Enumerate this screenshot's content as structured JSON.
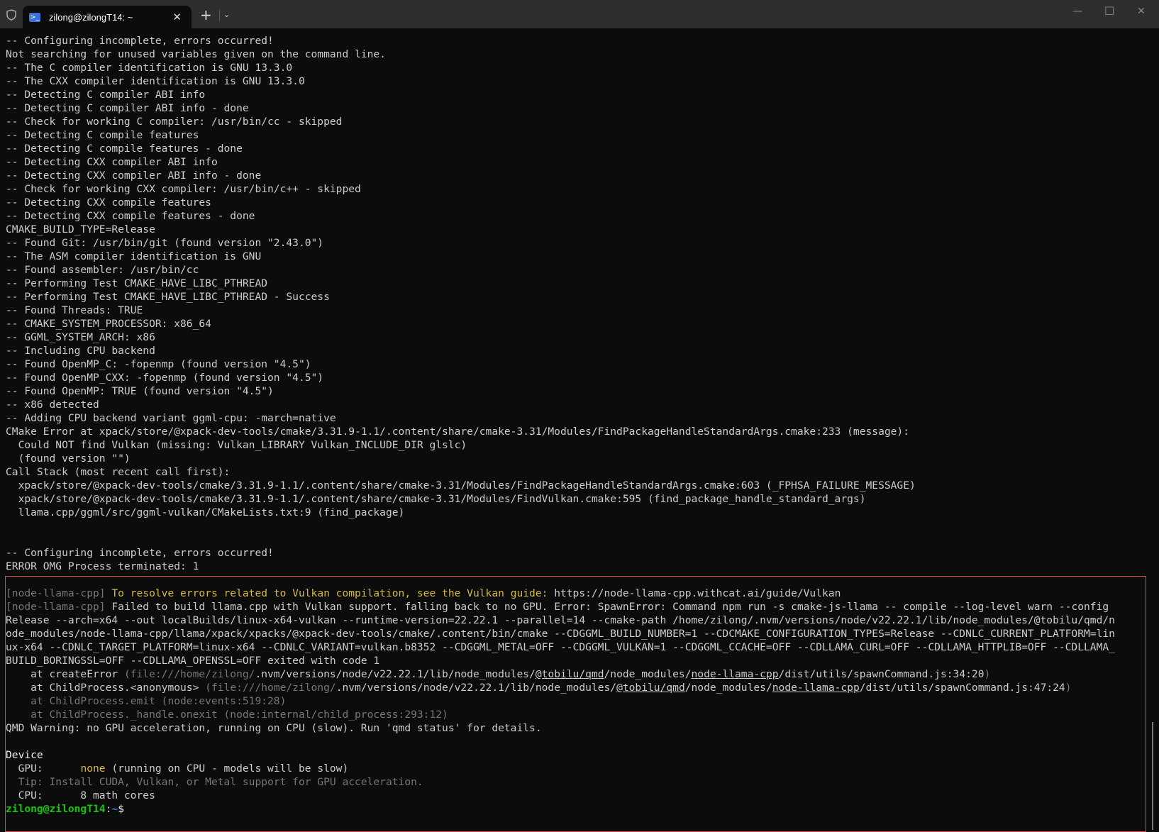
{
  "window": {
    "tab_title": "zilong@zilongT14: ~",
    "tab_icon": "powershell-icon",
    "new_tab": "+",
    "dropdown": "⌄",
    "close_tab": "✕",
    "minimize": "—",
    "maximize": "☐",
    "close": "✕"
  },
  "colors": {
    "error_box": "#e0474f",
    "prompt_user": "#16c60c",
    "prompt_path": "#3b78ff",
    "warning": "#d7b83f"
  },
  "lines": [
    [
      [
        "-- Configuring incomplete, errors occurred!",
        ""
      ]
    ],
    [
      [
        "Not searching for unused variables given on the command line.",
        ""
      ]
    ],
    [
      [
        "-- The C compiler identification is GNU 13.3.0",
        ""
      ]
    ],
    [
      [
        "-- The CXX compiler identification is GNU 13.3.0",
        ""
      ]
    ],
    [
      [
        "-- Detecting C compiler ABI info",
        ""
      ]
    ],
    [
      [
        "-- Detecting C compiler ABI info - done",
        ""
      ]
    ],
    [
      [
        "-- Check for working C compiler: /usr/bin/cc - skipped",
        ""
      ]
    ],
    [
      [
        "-- Detecting C compile features",
        ""
      ]
    ],
    [
      [
        "-- Detecting C compile features - done",
        ""
      ]
    ],
    [
      [
        "-- Detecting CXX compiler ABI info",
        ""
      ]
    ],
    [
      [
        "-- Detecting CXX compiler ABI info - done",
        ""
      ]
    ],
    [
      [
        "-- Check for working CXX compiler: /usr/bin/c++ - skipped",
        ""
      ]
    ],
    [
      [
        "-- Detecting CXX compile features",
        ""
      ]
    ],
    [
      [
        "-- Detecting CXX compile features - done",
        ""
      ]
    ],
    [
      [
        "CMAKE_BUILD_TYPE=Release",
        ""
      ]
    ],
    [
      [
        "-- Found Git: /usr/bin/git (found version \"2.43.0\")",
        ""
      ]
    ],
    [
      [
        "-- The ASM compiler identification is GNU",
        ""
      ]
    ],
    [
      [
        "-- Found assembler: /usr/bin/cc",
        ""
      ]
    ],
    [
      [
        "-- Performing Test CMAKE_HAVE_LIBC_PTHREAD",
        ""
      ]
    ],
    [
      [
        "-- Performing Test CMAKE_HAVE_LIBC_PTHREAD - Success",
        ""
      ]
    ],
    [
      [
        "-- Found Threads: TRUE",
        ""
      ]
    ],
    [
      [
        "-- CMAKE_SYSTEM_PROCESSOR: x86_64",
        ""
      ]
    ],
    [
      [
        "-- GGML_SYSTEM_ARCH: x86",
        ""
      ]
    ],
    [
      [
        "-- Including CPU backend",
        ""
      ]
    ],
    [
      [
        "-- Found OpenMP_C: -fopenmp (found version \"4.5\")",
        ""
      ]
    ],
    [
      [
        "-- Found OpenMP_CXX: -fopenmp (found version \"4.5\")",
        ""
      ]
    ],
    [
      [
        "-- Found OpenMP: TRUE (found version \"4.5\")",
        ""
      ]
    ],
    [
      [
        "-- x86 detected",
        ""
      ]
    ],
    [
      [
        "-- Adding CPU backend variant ggml-cpu: -march=native",
        ""
      ]
    ],
    [
      [
        "CMake Error at xpack/store/@xpack-dev-tools/cmake/3.31.9-1.1/.content/share/cmake-3.31/Modules/FindPackageHandleStandardArgs.cmake:233 (message):",
        ""
      ]
    ],
    [
      [
        "  Could NOT find Vulkan (missing: Vulkan_LIBRARY Vulkan_INCLUDE_DIR glslc)",
        ""
      ]
    ],
    [
      [
        "  (found version \"\")",
        ""
      ]
    ],
    [
      [
        "Call Stack (most recent call first):",
        ""
      ]
    ],
    [
      [
        "  xpack/store/@xpack-dev-tools/cmake/3.31.9-1.1/.content/share/cmake-3.31/Modules/FindPackageHandleStandardArgs.cmake:603 (_FPHSA_FAILURE_MESSAGE)",
        ""
      ]
    ],
    [
      [
        "  xpack/store/@xpack-dev-tools/cmake/3.31.9-1.1/.content/share/cmake-3.31/Modules/FindVulkan.cmake:595 (find_package_handle_standard_args)",
        ""
      ]
    ],
    [
      [
        "  llama.cpp/ggml/src/ggml-vulkan/CMakeLists.txt:9 (find_package)",
        ""
      ]
    ],
    [],
    [],
    [
      [
        "-- Configuring incomplete, errors occurred!",
        ""
      ]
    ],
    [
      [
        "ERROR OMG Process terminated: 1",
        ""
      ]
    ],
    [],
    [
      [
        "[node-llama-cpp] ",
        "dim"
      ],
      [
        "To resolve errors related to Vulkan compilation, see the Vulkan guide: ",
        "yel"
      ],
      [
        "https://node-llama-cpp.withcat.ai/guide/Vulkan",
        ""
      ]
    ],
    [
      [
        "[node-llama-cpp] ",
        "dim"
      ],
      [
        "Failed to build llama.cpp with Vulkan support. falling back to no GPU. Error: SpawnError: Command npm run -s cmake-js-llama -- compile --log-level warn --config",
        ""
      ]
    ],
    [
      [
        "Release --arch=x64 --out localBuilds/linux-x64-vulkan --runtime-version=22.22.1 --parallel=14 --cmake-path /home/zilong/.nvm/versions/node/v22.22.1/lib/node_modules/@tobilu/qmd/n",
        ""
      ]
    ],
    [
      [
        "ode_modules/node-llama-cpp/llama/xpack/xpacks/@xpack-dev-tools/cmake/.content/bin/cmake --CDGGML_BUILD_NUMBER=1 --CDCMAKE_CONFIGURATION_TYPES=Release --CDNLC_CURRENT_PLATFORM=lin",
        ""
      ]
    ],
    [
      [
        "ux-x64 --CDNLC_TARGET_PLATFORM=linux-x64 --CDNLC_VARIANT=vulkan.b8352 --CDGGML_METAL=OFF --CDGGML_VULKAN=1 --CDGGML_CCACHE=OFF --CDLLAMA_CURL=OFF --CDLLAMA_HTTPLIB=OFF --CDLLAMA_",
        ""
      ]
    ],
    [
      [
        "BUILD_BORINGSSL=OFF --CDLLAMA_OPENSSL=OFF exited with code 1",
        ""
      ]
    ],
    [
      [
        "    at createError ",
        ""
      ],
      [
        "(file:///home/zilong/",
        "dim"
      ],
      [
        ".nvm/versions/node/v22.22.1/lib/node_modules/",
        ""
      ],
      [
        "@tobilu/qmd",
        "ul"
      ],
      [
        "/node_modules/",
        ""
      ],
      [
        "node-llama-cpp",
        "ul"
      ],
      [
        "/dist/utils/spawnCommand.js:34:20",
        ""
      ],
      [
        ")",
        "dim"
      ]
    ],
    [
      [
        "    at ChildProcess.<anonymous> ",
        ""
      ],
      [
        "(file:///home/zilong/",
        "dim"
      ],
      [
        ".nvm/versions/node/v22.22.1/lib/node_modules/",
        ""
      ],
      [
        "@tobilu/qmd",
        "ul"
      ],
      [
        "/node_modules/",
        ""
      ],
      [
        "node-llama-cpp",
        "ul"
      ],
      [
        "/dist/utils/spawnCommand.js:47:24",
        ""
      ],
      [
        ")",
        "dim"
      ]
    ],
    [
      [
        "    at ChildProcess.emit (node:events:519:28)",
        "dim"
      ]
    ],
    [
      [
        "    at ChildProcess._handle.onexit (node:internal/child_process:293:12)",
        "dim"
      ]
    ],
    [
      [
        "QMD Warning: no GPU acceleration, running on CPU (slow). Run 'qmd status' for details.",
        ""
      ]
    ],
    [],
    [
      [
        "Device",
        "white"
      ]
    ],
    [
      [
        "  GPU:      ",
        ""
      ],
      [
        "none",
        "yel"
      ],
      [
        " (running on CPU - models will be slow)",
        ""
      ]
    ],
    [
      [
        "  Tip: Install CUDA, Vulkan, or Metal support for GPU acceleration.",
        "dim"
      ]
    ],
    [
      [
        "  CPU:      8 math cores",
        ""
      ]
    ],
    [
      [
        "zilong@zilongT14",
        "green"
      ],
      [
        ":",
        ""
      ],
      [
        "~",
        "blue"
      ],
      [
        "$ ",
        "white"
      ]
    ]
  ]
}
